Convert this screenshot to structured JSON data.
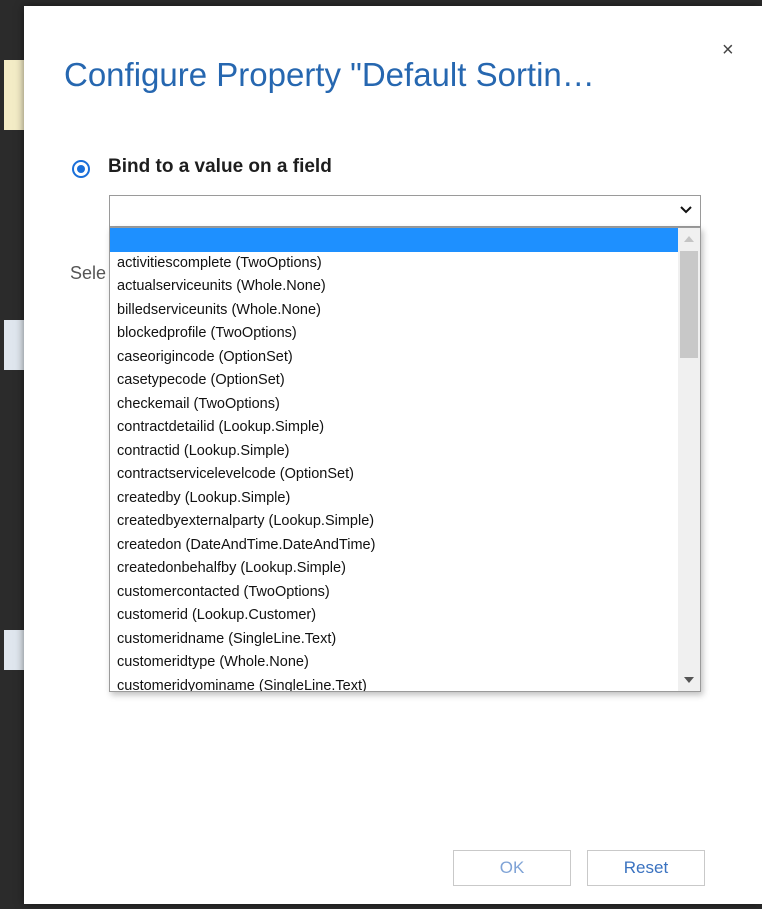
{
  "dialog": {
    "title": "Configure Property \"Default Sortin…",
    "close_symbol": "×",
    "radio_label": "Bind to a value on a field",
    "behind_label": "Sele",
    "select_value": "",
    "options": [
      "",
      "activitiescomplete (TwoOptions)",
      "actualserviceunits (Whole.None)",
      "billedserviceunits (Whole.None)",
      "blockedprofile (TwoOptions)",
      "caseorigincode (OptionSet)",
      "casetypecode (OptionSet)",
      "checkemail (TwoOptions)",
      "contractdetailid (Lookup.Simple)",
      "contractid (Lookup.Simple)",
      "contractservicelevelcode (OptionSet)",
      "createdby (Lookup.Simple)",
      "createdbyexternalparty (Lookup.Simple)",
      "createdon (DateAndTime.DateAndTime)",
      "createdonbehalfby (Lookup.Simple)",
      "customercontacted (TwoOptions)",
      "customerid (Lookup.Customer)",
      "customeridname (SingleLine.Text)",
      "customeridtype (Whole.None)",
      "customeridyominame (SingleLine.Text)"
    ],
    "selected_option_index": 0,
    "ok_label": "OK",
    "reset_label": "Reset"
  },
  "colors": {
    "title": "#2667b0",
    "accent": "#1e90ff",
    "radio": "#1a6fd9"
  },
  "icons": {
    "close": "close-icon",
    "chevron": "chevron-down-icon",
    "scroll_up": "scroll-up-arrow-icon",
    "scroll_down": "scroll-down-arrow-icon"
  }
}
